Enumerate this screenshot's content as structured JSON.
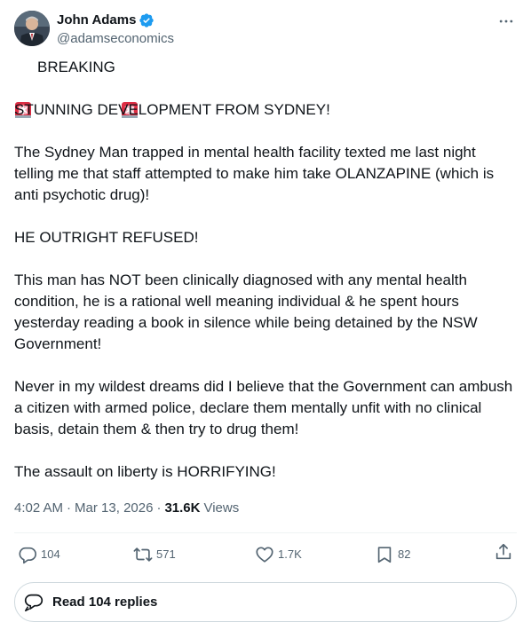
{
  "author": {
    "display_name": "John Adams",
    "handle": "@adamseconomics",
    "verified": true
  },
  "tweet": {
    "breaking_label": "BREAKING",
    "paragraphs": [
      "STUNNING DEVELOPMENT FROM SYDNEY!",
      "The Sydney Man trapped in mental health facility texted me last night telling me that staff attempted to make him take OLANZAPINE (which is anti psychotic drug)!",
      "HE OUTRIGHT REFUSED!",
      "This man has NOT been clinically diagnosed with any mental health condition, he is a rational well meaning individual & he spent hours yesterday reading a book in silence while being detained by the NSW Government!",
      "Never in my wildest dreams did I believe that the Government can ambush a citizen with armed police, declare them mentally unfit with no clinical basis, detain them & then try to drug them!",
      "The assault on liberty is HORRIFYING!"
    ]
  },
  "meta": {
    "time": "4:02 AM",
    "separator": "·",
    "date": "Mar 13, 2026",
    "views_count": "31.6K",
    "views_label": "Views"
  },
  "actions": {
    "replies": "104",
    "reposts": "571",
    "likes": "1.7K",
    "bookmarks": "82"
  },
  "read_replies_label": "Read 104 replies",
  "icons": {
    "verified": "verified-badge-icon",
    "siren": "police-light-icon",
    "more": "more-dots-icon",
    "reply": "reply-icon",
    "repost": "repost-icon",
    "like": "heart-icon",
    "bookmark": "bookmark-icon",
    "share": "share-icon"
  },
  "colors": {
    "text_primary": "#0f1419",
    "text_secondary": "#536471",
    "verified_blue": "#1d9bf0",
    "border": "#cfd9de",
    "divider": "#eff3f4"
  }
}
